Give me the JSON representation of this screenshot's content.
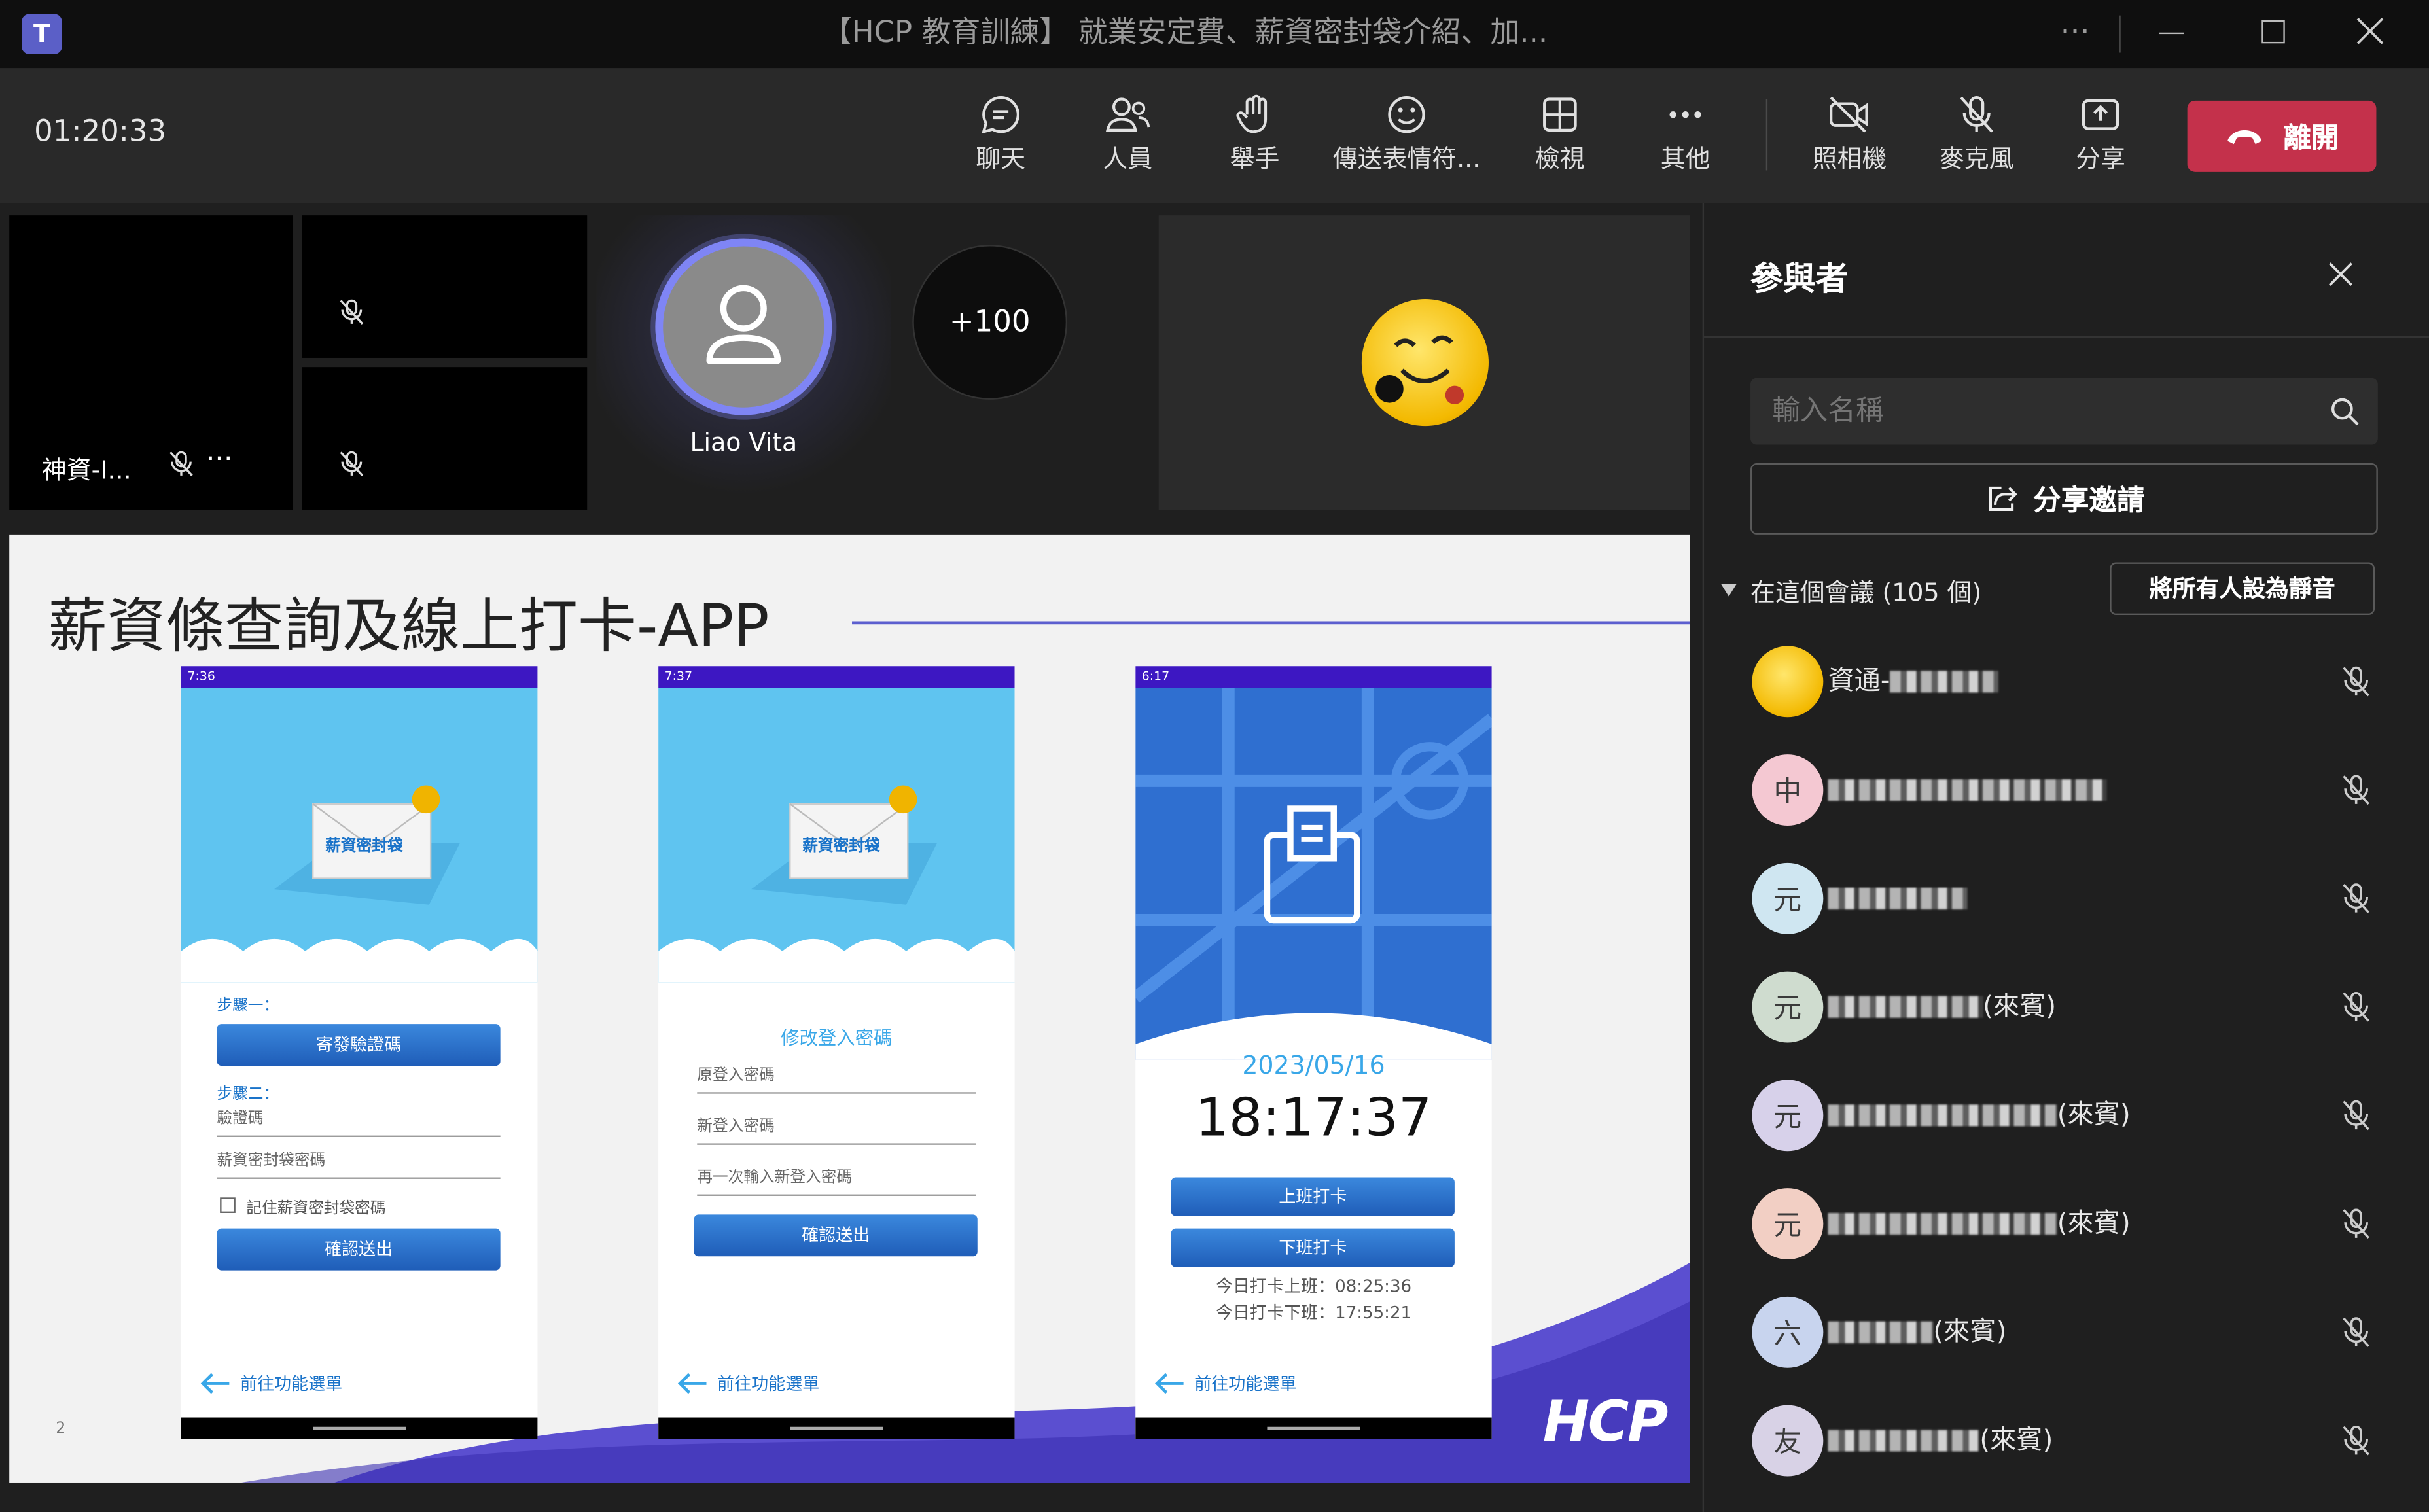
{
  "window": {
    "title": "【HCP 教育訓練】 就業安定費、薪資密封袋介紹、加..."
  },
  "toolbar": {
    "timer": "01:20:33",
    "buttons": [
      {
        "label": "聊天",
        "icon": "chat-icon"
      },
      {
        "label": "人員",
        "icon": "people-icon",
        "active": true
      },
      {
        "label": "舉手",
        "icon": "raise-hand-icon"
      },
      {
        "label": "傳送表情符...",
        "icon": "emoji-icon"
      },
      {
        "label": "檢視",
        "icon": "view-grid-icon"
      },
      {
        "label": "其他",
        "icon": "more-icon"
      },
      {
        "label": "照相機",
        "icon": "camera-off-icon"
      },
      {
        "label": "麥克風",
        "icon": "mic-off-icon"
      },
      {
        "label": "分享",
        "icon": "share-icon"
      }
    ],
    "leave_label": "離開",
    "accent": "#7f85f5",
    "leave_color": "#c4314b"
  },
  "stage": {
    "tile1_name": "神資-I...",
    "featured_name": "Liao Vita",
    "overflow_count": "+100"
  },
  "slide": {
    "title": "薪資條查詢及線上打卡-APP",
    "page_number": "2",
    "logo": "HCP",
    "phone1": {
      "status_time": "7:36",
      "envelope_label": "薪資密封袋",
      "step1": "步驟一：",
      "send_code_button": "寄發驗證碼",
      "step2": "步驟二：",
      "field_code": "驗證碼",
      "field_password": "薪資密封袋密碼",
      "remember": "記住薪資密封袋密碼",
      "confirm_button": "確認送出",
      "back": "前往功能選單"
    },
    "phone2": {
      "status_time": "7:37",
      "envelope_label": "薪資密封袋",
      "heading": "修改登入密碼",
      "field_old": "原登入密碼",
      "field_new": "新登入密碼",
      "field_repeat": "再一次輸入新登入密碼",
      "confirm_button": "確認送出",
      "back": "前往功能選單"
    },
    "phone3": {
      "status_time": "6:17",
      "date": "2023/05/16",
      "time": "18:17:37",
      "clock_in_button": "上班打卡",
      "clock_out_button": "下班打卡",
      "today_in": "今日打卡上班：08:25:36",
      "today_out": "今日打卡下班：17:55:21",
      "back": "前往功能選單"
    }
  },
  "panel": {
    "title": "參與者",
    "search_placeholder": "輸入名稱",
    "share_invite_label": "分享邀請",
    "section_label": "在這個會議 (105 個)",
    "mute_all_label": "將所有人設為靜音",
    "participants": [
      {
        "initial": "",
        "name": "資通-",
        "suffix": "",
        "color": "#f5c400"
      },
      {
        "initial": "中",
        "name": "",
        "suffix": "",
        "color": "#f4c8d2"
      },
      {
        "initial": "元",
        "name": "",
        "suffix": "",
        "color": "#cfe6f1"
      },
      {
        "initial": "元",
        "name": "",
        "suffix": "(來賓)",
        "color": "#cfdccf"
      },
      {
        "initial": "元",
        "name": "",
        "suffix": "(來賓)",
        "color": "#d7d1ea"
      },
      {
        "initial": "元",
        "name": "",
        "suffix": "(來賓)",
        "color": "#f2cfc4"
      },
      {
        "initial": "六",
        "name": "",
        "suffix": "(來賓)",
        "color": "#c8d4ee"
      },
      {
        "initial": "友",
        "name": "",
        "suffix": "(來賓)",
        "color": "#d8d2e6"
      }
    ]
  }
}
